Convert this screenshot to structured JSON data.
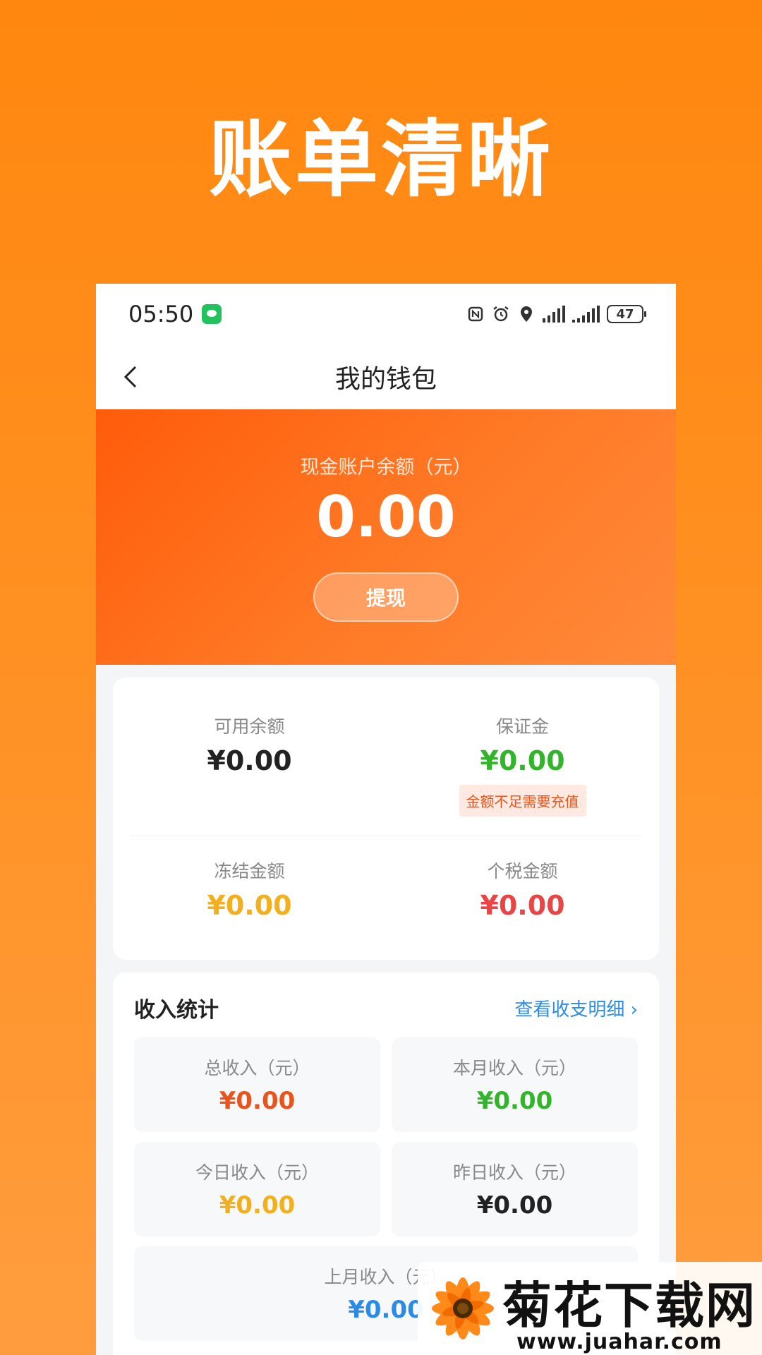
{
  "promo": {
    "title": "账单清晰"
  },
  "status_bar": {
    "time": "05:50",
    "battery": "47"
  },
  "nav": {
    "title": "我的钱包"
  },
  "hero": {
    "label": "现金账户余额（元）",
    "amount": "0.00",
    "withdraw_label": "提现"
  },
  "balances": {
    "available": {
      "label": "可用余额",
      "value": "¥0.00",
      "color": "#222222"
    },
    "deposit": {
      "label": "保证金",
      "value": "¥0.00",
      "color": "#33b52b",
      "warning": "金额不足需要充值"
    },
    "frozen": {
      "label": "冻结金额",
      "value": "¥0.00",
      "color": "#f2b01e"
    },
    "tax": {
      "label": "个税金额",
      "value": "¥0.00",
      "color": "#e84646"
    }
  },
  "income": {
    "title": "收入统计",
    "detail_link": "查看收支明细 ›",
    "total": {
      "label": "总收入（元）",
      "value": "¥0.00",
      "color": "#e8541c"
    },
    "month": {
      "label": "本月收入（元）",
      "value": "¥0.00",
      "color": "#33b52b"
    },
    "today": {
      "label": "今日收入（元）",
      "value": "¥0.00",
      "color": "#f2b01e"
    },
    "yesterday": {
      "label": "昨日收入（元）",
      "value": "¥0.00",
      "color": "#222222"
    },
    "last_month": {
      "label": "上月收入（元）",
      "value": "¥0.00",
      "color": "#2a8ce6"
    }
  },
  "watermark": {
    "name": "菊花下载网",
    "url": "www.juahar.com"
  }
}
